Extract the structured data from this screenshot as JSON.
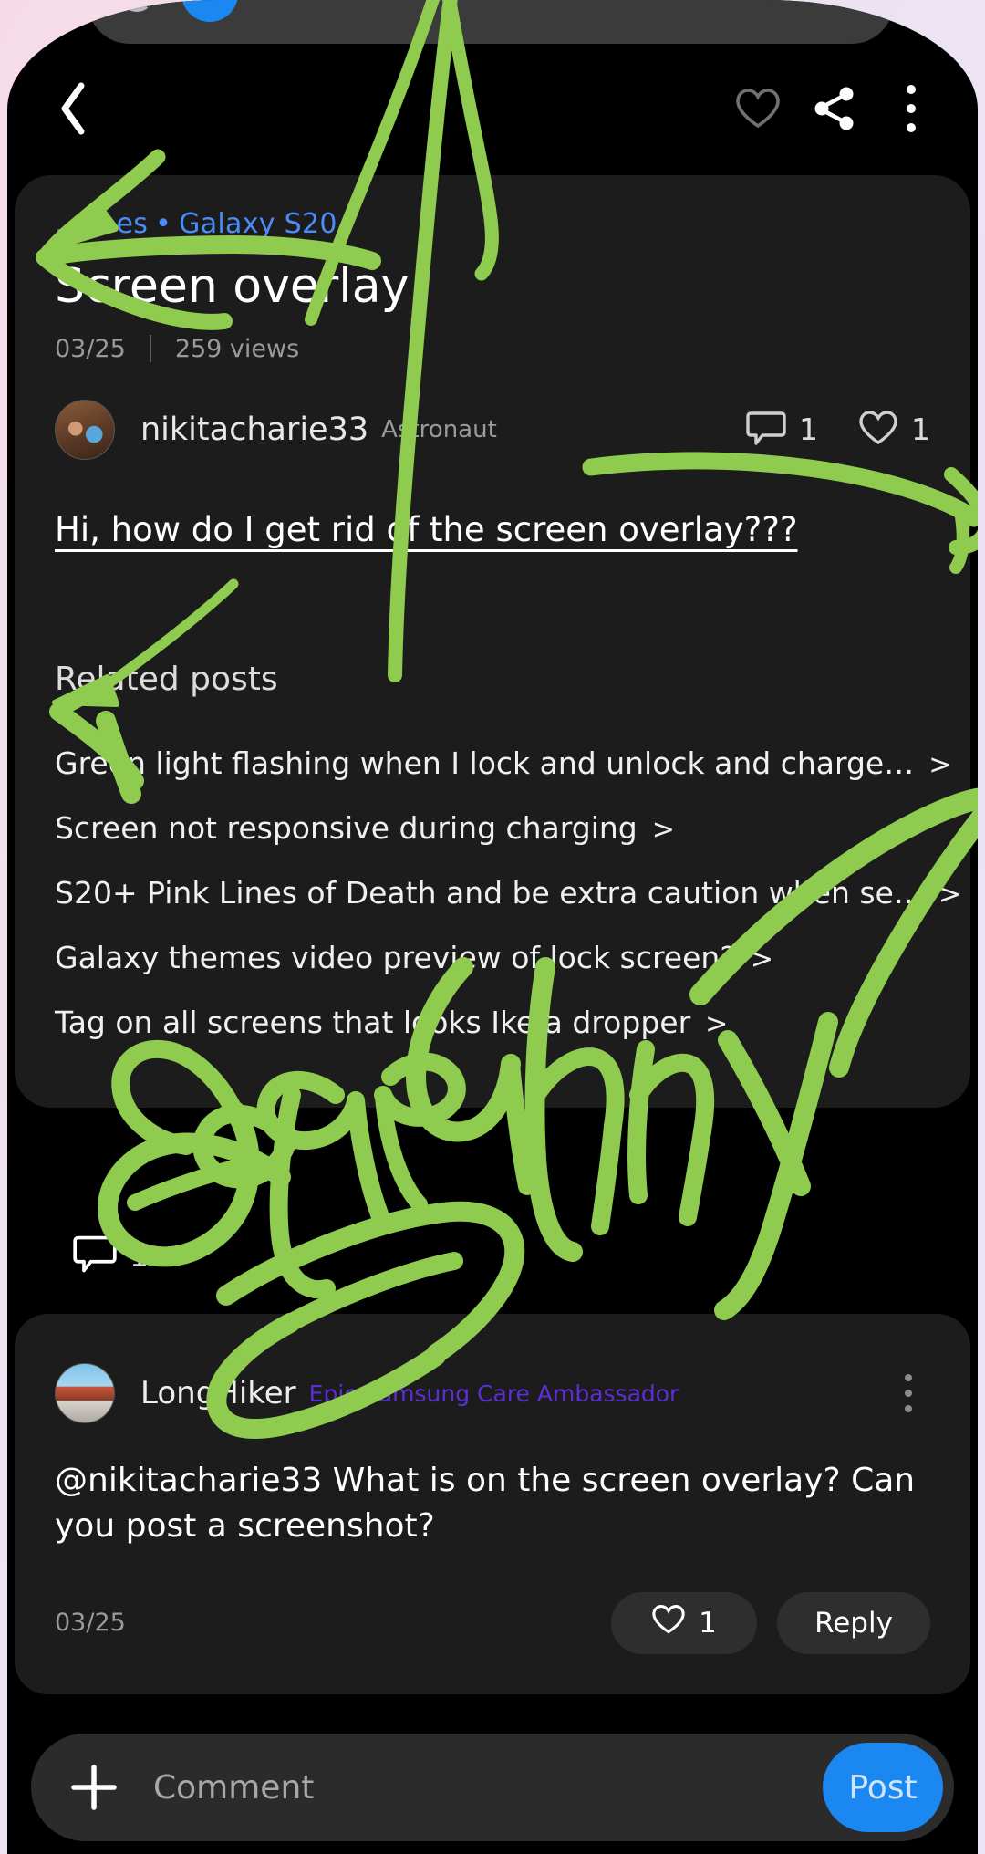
{
  "system_overlay": {
    "name": "volume-slider",
    "mute_icon": "volume-muted-icon",
    "expand_icon": "chevron-down-icon",
    "level_percent": 6
  },
  "topbar": {
    "back_icon": "back-chevron-icon",
    "favorite_icon": "heart-outline-icon",
    "share_icon": "share-icon",
    "more_icon": "more-vertical-icon"
  },
  "article": {
    "breadcrumb": {
      "category": "...ones",
      "separator": "•",
      "subcategory": "Galaxy S20"
    },
    "title": "Screen overlay",
    "date": "03/25",
    "views": "259 views",
    "author": {
      "name": "nikitacharie33",
      "rank": "Astronaut",
      "avatar": "author-avatar"
    },
    "stats": {
      "comment_icon": "comment-bubble-icon",
      "comment_count": "1",
      "like_icon": "heart-outline-icon",
      "like_count": "1"
    },
    "body": "Hi, how do I get rid of the screen overlay??? ",
    "related_heading": "Related posts",
    "related_posts": [
      {
        "title": "Green light flashing when I lock and unlock and charge…",
        "chevron": ">"
      },
      {
        "title": "Screen not responsive during charging",
        "chevron": ">"
      },
      {
        "title": "S20+ Pink Lines of Death and be extra caution when se…",
        "chevron": ">"
      },
      {
        "title": "Galaxy themes video preview of lock screen?",
        "chevron": ">"
      },
      {
        "title": "Tag on all screens that looks Ike a dropper",
        "chevron": ">"
      }
    ]
  },
  "comment_strip": {
    "icon": "comment-bubble-icon",
    "count": "1"
  },
  "comment": {
    "author": {
      "name": "LongHiker",
      "badge": "Epic Samsung Care Ambassador",
      "avatar": "commenter-avatar"
    },
    "more_icon": "more-vertical-icon",
    "text": "@nikitacharie33 What is on the screen overlay? Can you post a screenshot?",
    "date": "03/25",
    "like_icon": "heart-outline-icon",
    "like_count": "1",
    "reply_label": "Reply"
  },
  "compose": {
    "add_icon": "plus-icon",
    "placeholder": "Comment",
    "value": "",
    "post_label": "Post"
  },
  "annotations": {
    "ink_color": "#8ecb4f",
    "handwriting": [
      "edge",
      "Ughhmy"
    ]
  },
  "colors": {
    "accent_blue": "#1b87f0",
    "link_blue": "#4b8df8",
    "badge_purple": "#5b2fd4",
    "card_bg": "#1c1c1c",
    "page_bg": "#000000",
    "ink_green": "#8ecb4f"
  }
}
